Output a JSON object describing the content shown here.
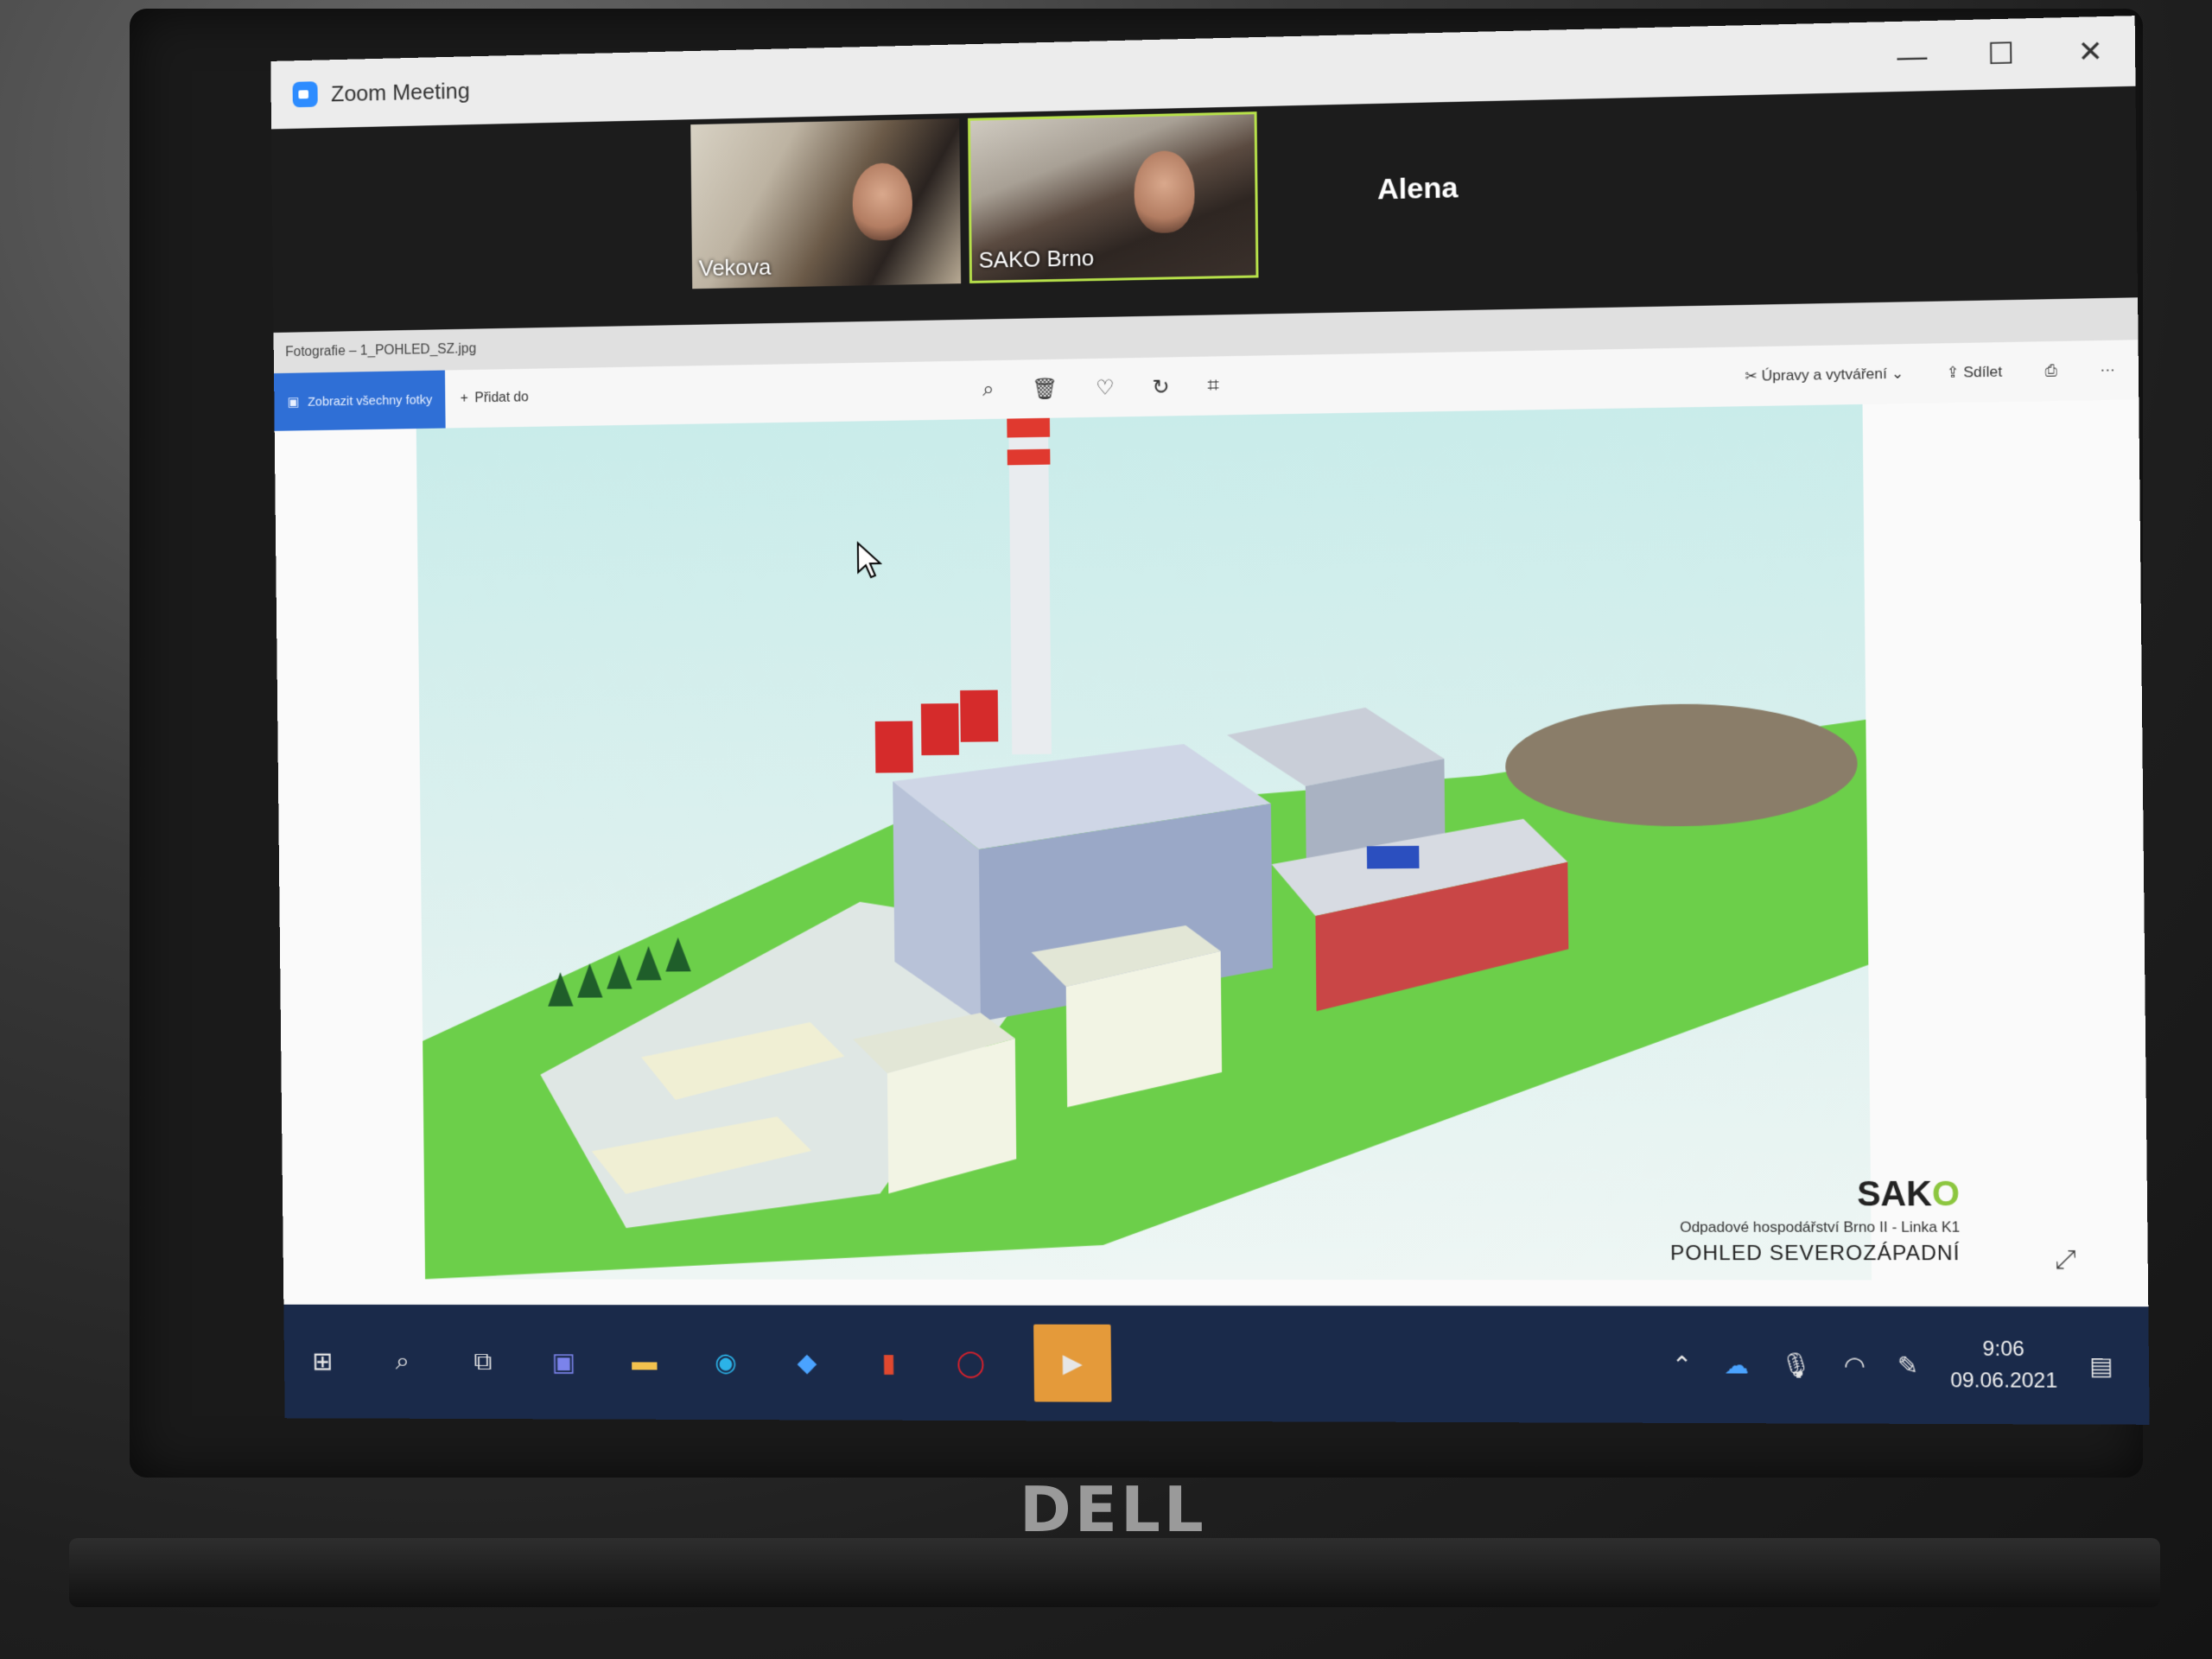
{
  "zoom": {
    "window_title": "Zoom Meeting",
    "participants": [
      {
        "label": "Vekova"
      },
      {
        "label": "SAKO Brno"
      }
    ],
    "name_only": "Alena",
    "controls": {
      "minimize": "—",
      "maximize": "☐",
      "close": "✕"
    }
  },
  "photos": {
    "file_title": "Fotografie – 1_POHLED_SZ.jpg",
    "view_all": "Zobrazit všechny fotky",
    "add_to": "Přidat do",
    "edit_create": "Úpravy a vytváření",
    "share": "Sdílet",
    "more": "···"
  },
  "image": {
    "brand": "SAKO",
    "subtitle": "Odpadové hospodářství Brno II - Linka K1",
    "view": "POHLED SEVEROZÁPADNÍ"
  },
  "taskbar": {
    "time": "9:06",
    "date": "09.06.2021"
  },
  "laptop": {
    "brand": "DELL"
  },
  "colors": {
    "accent": "#2f6fd6",
    "zoom_active": "#e49a3a",
    "speaker_border": "#b7e14a",
    "grass": "#6ccf4a"
  }
}
